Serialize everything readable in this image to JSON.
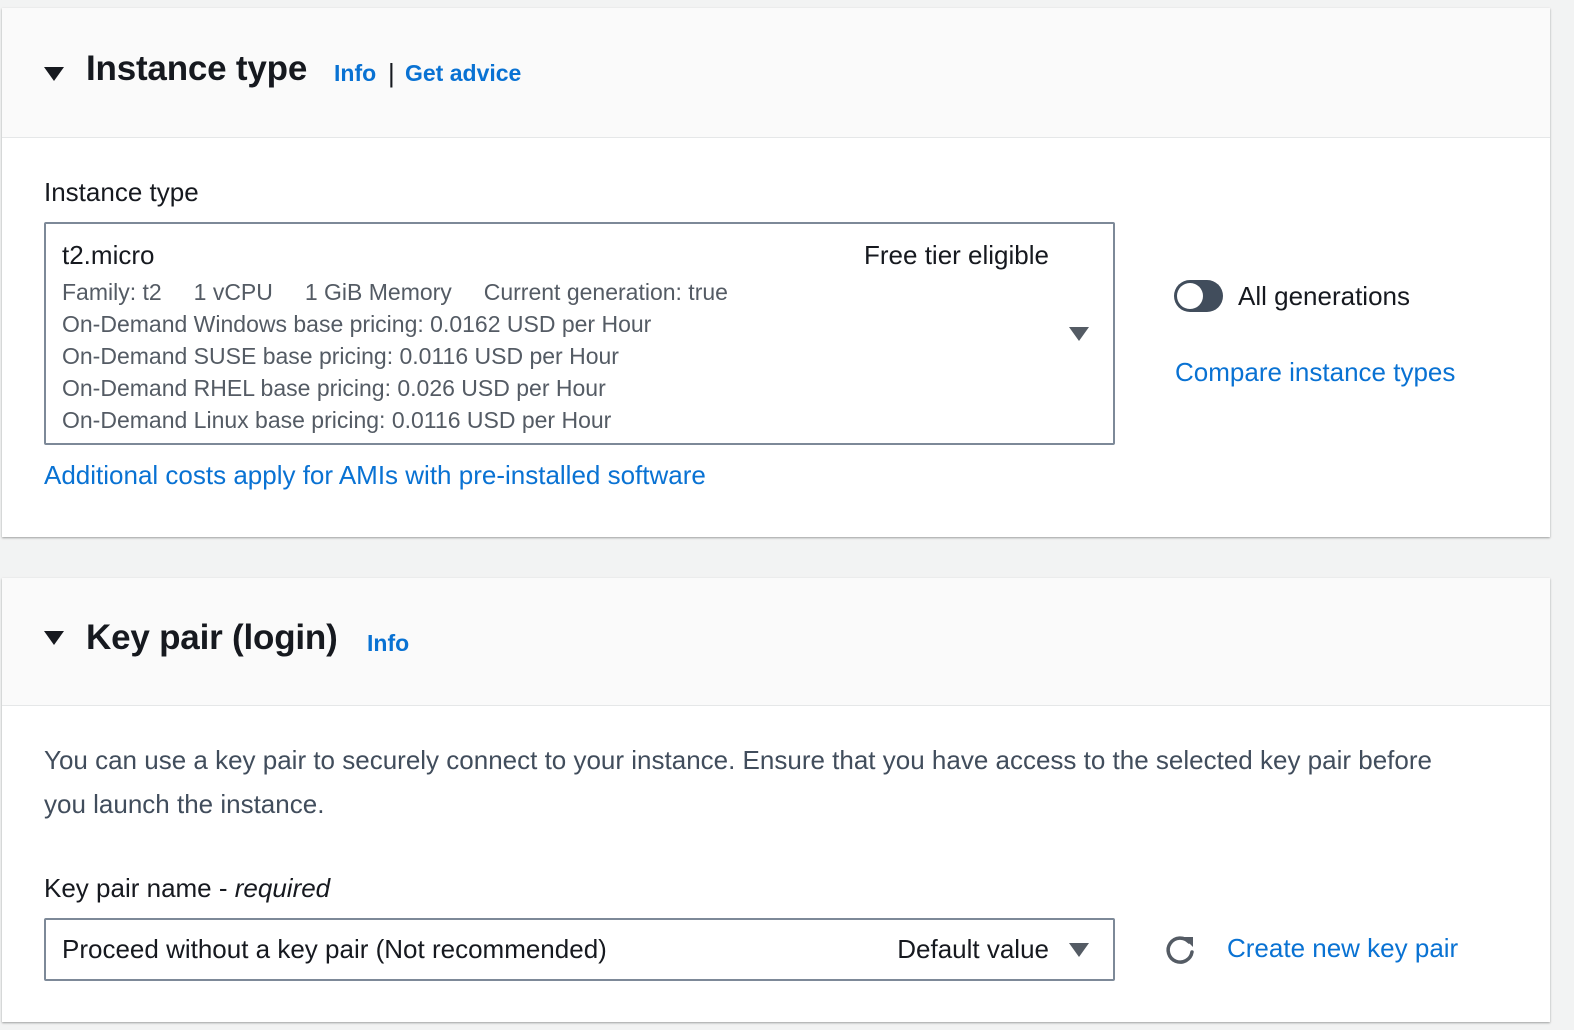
{
  "instance_section": {
    "title": "Instance type",
    "info_link": "Info",
    "separator": "|",
    "get_advice_link": "Get advice",
    "field_label": "Instance type",
    "selected": {
      "name": "t2.micro",
      "tag": "Free tier eligible",
      "details": [
        "Family: t2     1 vCPU     1 GiB Memory     Current generation: true",
        "On-Demand Windows base pricing: 0.0162 USD per Hour",
        "On-Demand SUSE base pricing: 0.0116 USD per Hour",
        "On-Demand RHEL base pricing: 0.026 USD per Hour",
        "On-Demand Linux base pricing: 0.0116 USD per Hour"
      ]
    },
    "additional_costs_link": "Additional costs apply for AMIs with pre-installed software",
    "all_generations_label": "All generations",
    "all_generations_enabled": false,
    "compare_link": "Compare instance types",
    "icons": {
      "collapse": "caret-down-icon",
      "dropdown": "dropdown-arrow-icon"
    }
  },
  "keypair_section": {
    "title": "Key pair (login)",
    "info_link": "Info",
    "description": "You can use a key pair to securely connect to your instance. Ensure that you have access to the selected key pair before you launch the instance.",
    "field_label": "Key pair name - ",
    "field_required": "required",
    "selected_value": "Proceed without a key pair (Not recommended)",
    "selected_tag": "Default value",
    "create_link": "Create new key pair",
    "icons": {
      "refresh": "refresh-icon",
      "dropdown": "dropdown-arrow-icon"
    }
  },
  "colors": {
    "link": "#0972d3",
    "text": "#16191f",
    "secondary_text": "#545b64",
    "page_bg": "#f2f3f3",
    "toggle_off": "#414d5c"
  }
}
